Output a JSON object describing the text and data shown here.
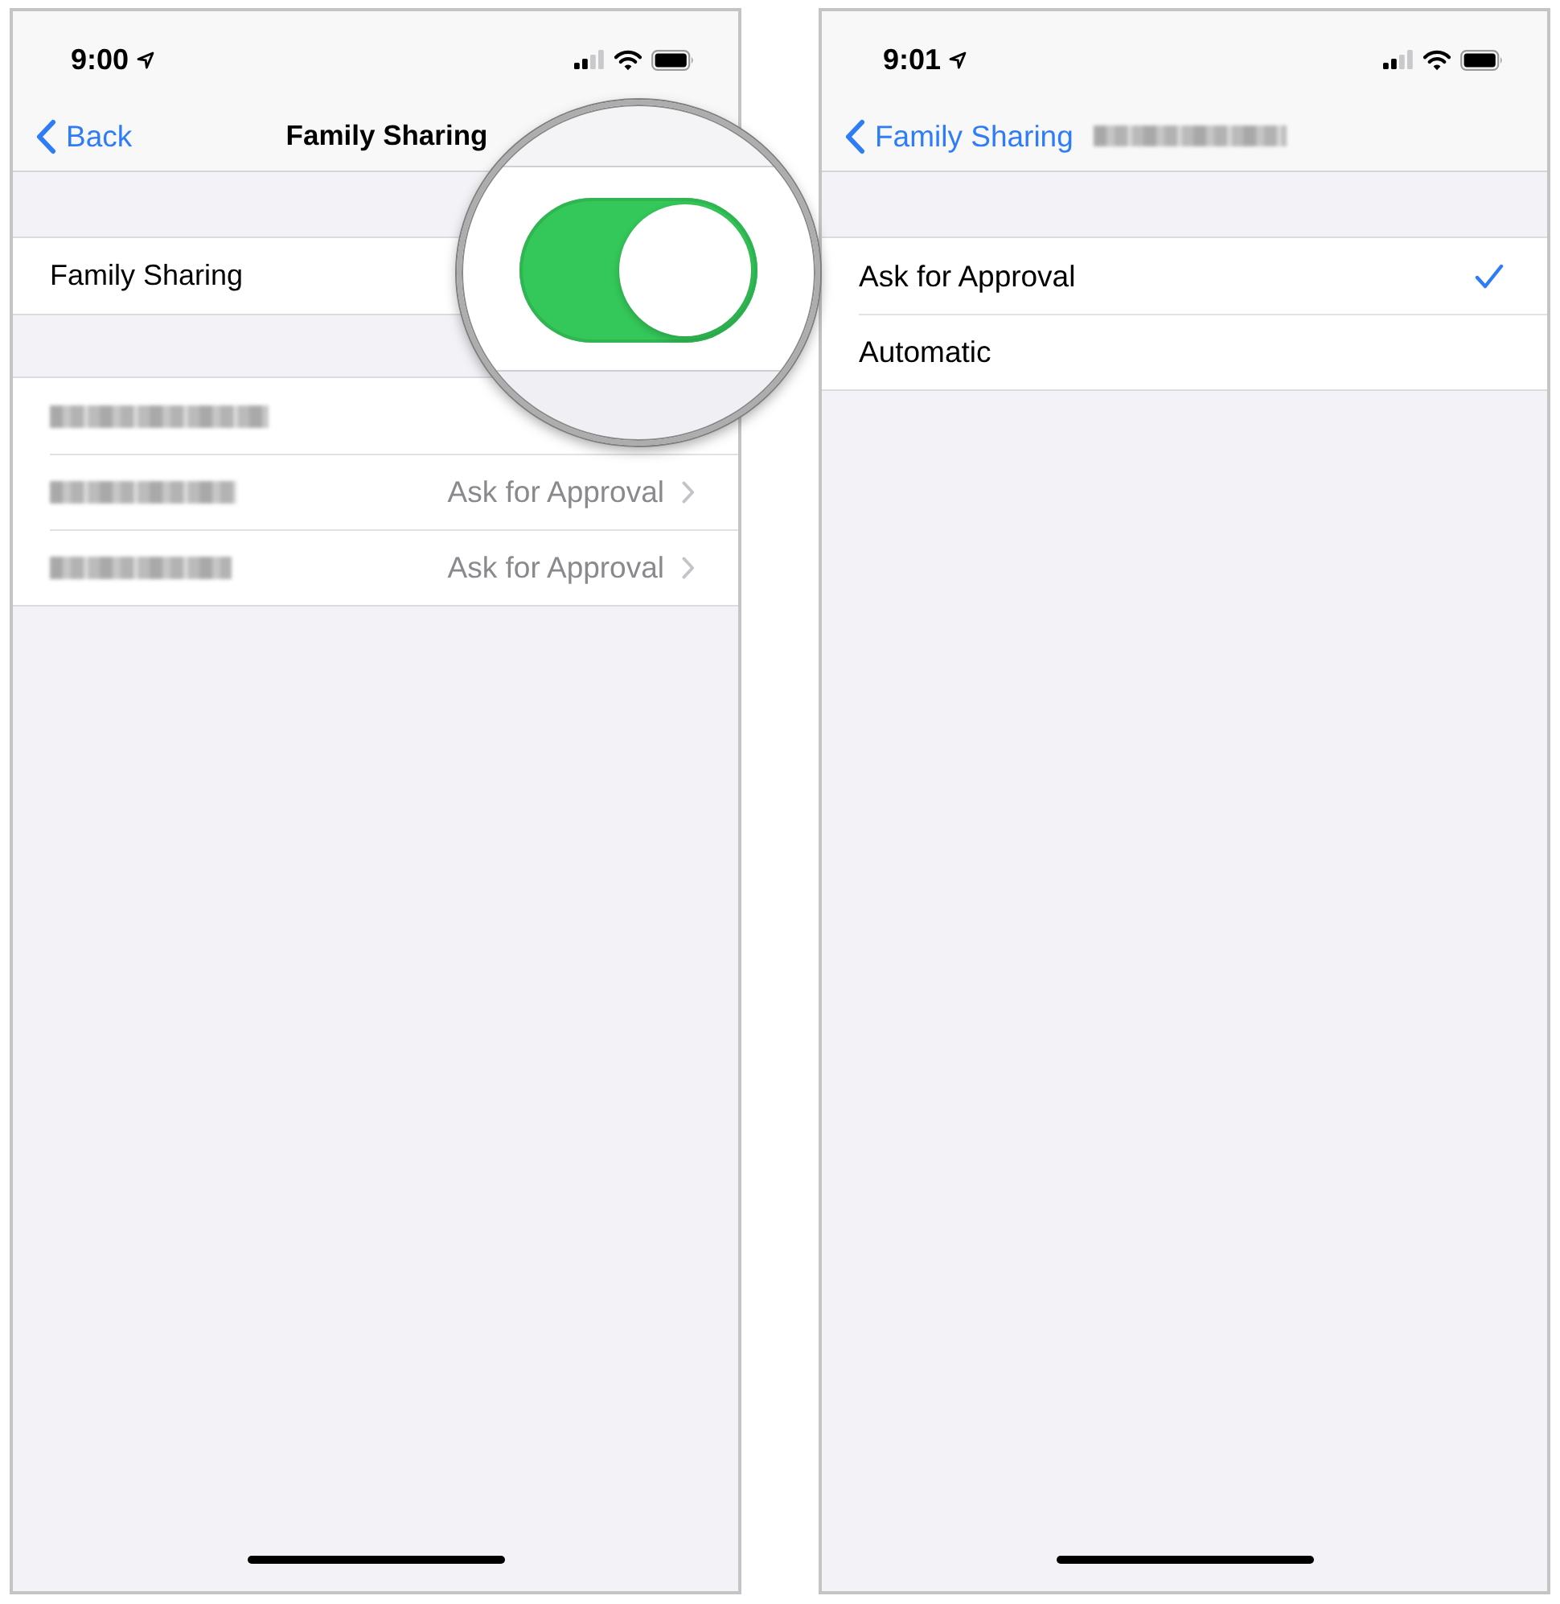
{
  "left_screen": {
    "status_bar": {
      "time": "9:00"
    },
    "nav_bar": {
      "back_label": "Back",
      "title": "Family Sharing"
    },
    "toggle_row": {
      "label": "Family Sharing",
      "on": true
    },
    "members": [
      {
        "name_redacted": true
      },
      {
        "name_redacted": true,
        "value": "Ask for Approval"
      },
      {
        "name_redacted": true,
        "value": "Ask for Approval"
      }
    ]
  },
  "right_screen": {
    "status_bar": {
      "time": "9:01"
    },
    "nav_bar": {
      "back_label": "Family Sharing",
      "title_redacted": true
    },
    "options": [
      {
        "label": "Ask for Approval",
        "selected": true
      },
      {
        "label": "Automatic",
        "selected": false
      }
    ]
  }
}
